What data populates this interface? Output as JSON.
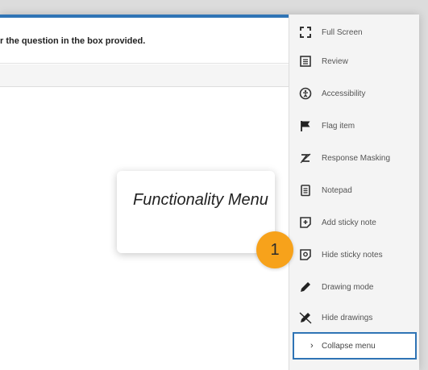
{
  "instruction": {
    "text": "r the question in the box provided."
  },
  "menu": {
    "items": [
      {
        "label": "Full Screen",
        "icon": "fullscreen-icon"
      },
      {
        "label": "Review",
        "icon": "review-icon"
      },
      {
        "label": "Accessibility",
        "icon": "accessibility-icon"
      },
      {
        "label": "Flag item",
        "icon": "flag-icon"
      },
      {
        "label": "Response Masking",
        "icon": "response-masking-icon"
      },
      {
        "label": "Notepad",
        "icon": "notepad-icon"
      },
      {
        "label": "Add sticky note",
        "icon": "add-sticky-note-icon"
      },
      {
        "label": "Hide sticky notes",
        "icon": "hide-sticky-notes-icon"
      },
      {
        "label": "Drawing mode",
        "icon": "pencil-icon"
      },
      {
        "label": "Hide drawings",
        "icon": "hide-drawings-icon"
      }
    ],
    "collapse_label": "Collapse menu"
  },
  "callout": {
    "text": "Functionality Menu",
    "badge": "1"
  },
  "colors": {
    "accent": "#2f74b5",
    "badge": "#f7a21b"
  }
}
